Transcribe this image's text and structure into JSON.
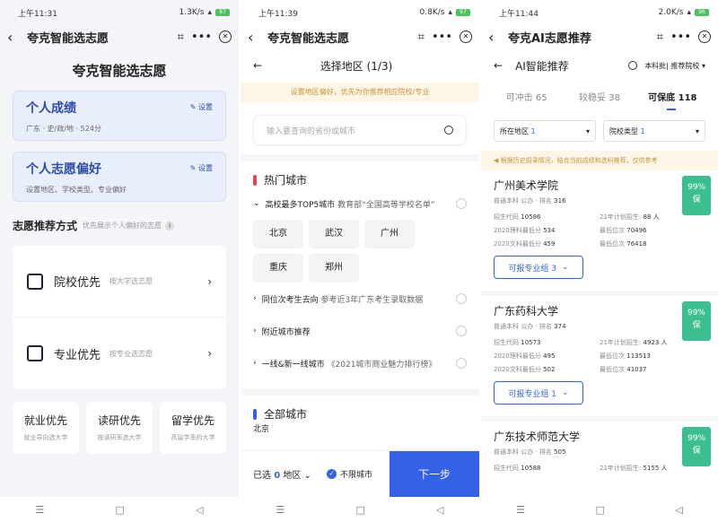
{
  "p1": {
    "status": {
      "time": "上午11:31",
      "speed": "1.3K/s",
      "battery": "97"
    },
    "title": "夸克智能选志愿",
    "header": "夸克智能选志愿",
    "card1": {
      "title": "个人成绩",
      "set": "设置",
      "sub": "广东 · 史/政/地 · 524分"
    },
    "card2": {
      "title": "个人志愿偏好",
      "set": "设置",
      "sub": "设置地区、学校类型、专业偏好"
    },
    "section": {
      "title": "志愿推荐方式",
      "hint": "优先展示个人偏好的志愿",
      "info": "i"
    },
    "options": [
      {
        "label": "院校优先",
        "sub": "按大学选志愿"
      },
      {
        "label": "专业优先",
        "sub": "按专业选志愿"
      }
    ],
    "small_options": [
      {
        "label": "就业优先",
        "sub": "就业导向选大学"
      },
      {
        "label": "读研优先",
        "sub": "按读研率选大学"
      },
      {
        "label": "留学优先",
        "sub": "高留学率的大学"
      }
    ]
  },
  "p2": {
    "status": {
      "time": "上午11:39",
      "speed": "0.8K/s",
      "battery": "97"
    },
    "title": "夸克智能选志愿",
    "page_title": "选择地区 (1/3)",
    "notice": "设置地区偏好，优先为你推荐相应院校/专业",
    "search_placeholder": "输入要查询的省份或城市",
    "hot_title": "热门城市",
    "top5": {
      "title": "高校最多TOP5城市",
      "sub": "教育部“全国高等学校名单”"
    },
    "cities": [
      "北京",
      "武汉",
      "广州",
      "重庆",
      "郑州"
    ],
    "rows": [
      {
        "title": "同位次考生去向",
        "sub": "参考近3年广东考生录取数据"
      },
      {
        "title": "附近城市推荐",
        "sub": ""
      },
      {
        "title": "一线&新一线城市",
        "sub": "《2021城市商业魅力排行榜》"
      }
    ],
    "all_title": "全部城市",
    "partial_city": "北京",
    "bottom": {
      "selected_prefix": "已选",
      "selected_count": "0",
      "selected_suffix": "地区",
      "unlimited": "不限城市",
      "next": "下一步"
    }
  },
  "p3": {
    "status": {
      "time": "上午11:44",
      "speed": "2.0K/s",
      "battery": "96"
    },
    "title": "夸克AI志愿推荐",
    "page_title": "AI智能推荐",
    "right_filter": "本科批| 推荐院校",
    "tabs": [
      {
        "label": "可冲击",
        "count": "65"
      },
      {
        "label": "较稳妥",
        "count": "38"
      },
      {
        "label": "可保底",
        "count": "118"
      }
    ],
    "filters": [
      {
        "label": "所在地区",
        "count": "1"
      },
      {
        "label": "院校类型",
        "count": "1"
      }
    ],
    "notice": "根据历史招录情况，结合当前成绩和选科推荐，仅供参考",
    "universities": [
      {
        "name": "广州美术学院",
        "type": "普通本科 公办",
        "rank_label": "排名",
        "rank": "316",
        "code_label": "招生代码",
        "code": "10586",
        "plan_label": "21年计划招生",
        "plan": "88 人",
        "score20_label": "2020理科最低分",
        "score20": "534",
        "pos20_label": "最低位次",
        "pos20": "70496",
        "score20w_label": "2020文科最低分",
        "score20w": "459",
        "pos20w_label": "最低位次",
        "pos20w": "76418",
        "prob": "99%",
        "prob_label": "保",
        "group": "可报专业组 3"
      },
      {
        "name": "广东药科大学",
        "type": "普通本科 公办",
        "rank_label": "排名",
        "rank": "374",
        "code_label": "招生代码",
        "code": "10573",
        "plan_label": "21年计划招生",
        "plan": "4923 人",
        "score20_label": "2020理科最低分",
        "score20": "495",
        "pos20_label": "最低位次",
        "pos20": "113513",
        "score20w_label": "2020文科最低分",
        "score20w": "502",
        "pos20w_label": "最低位次",
        "pos20w": "41037",
        "prob": "99%",
        "prob_label": "保",
        "group": "可报专业组 1"
      },
      {
        "name": "广东技术师范大学",
        "type": "普通本科 公办",
        "rank_label": "排名",
        "rank": "505",
        "code_label": "招生代码",
        "code": "10588",
        "plan_label": "21年计划招生",
        "plan": "5155 人",
        "prob": "99%",
        "prob_label": "保"
      }
    ]
  }
}
